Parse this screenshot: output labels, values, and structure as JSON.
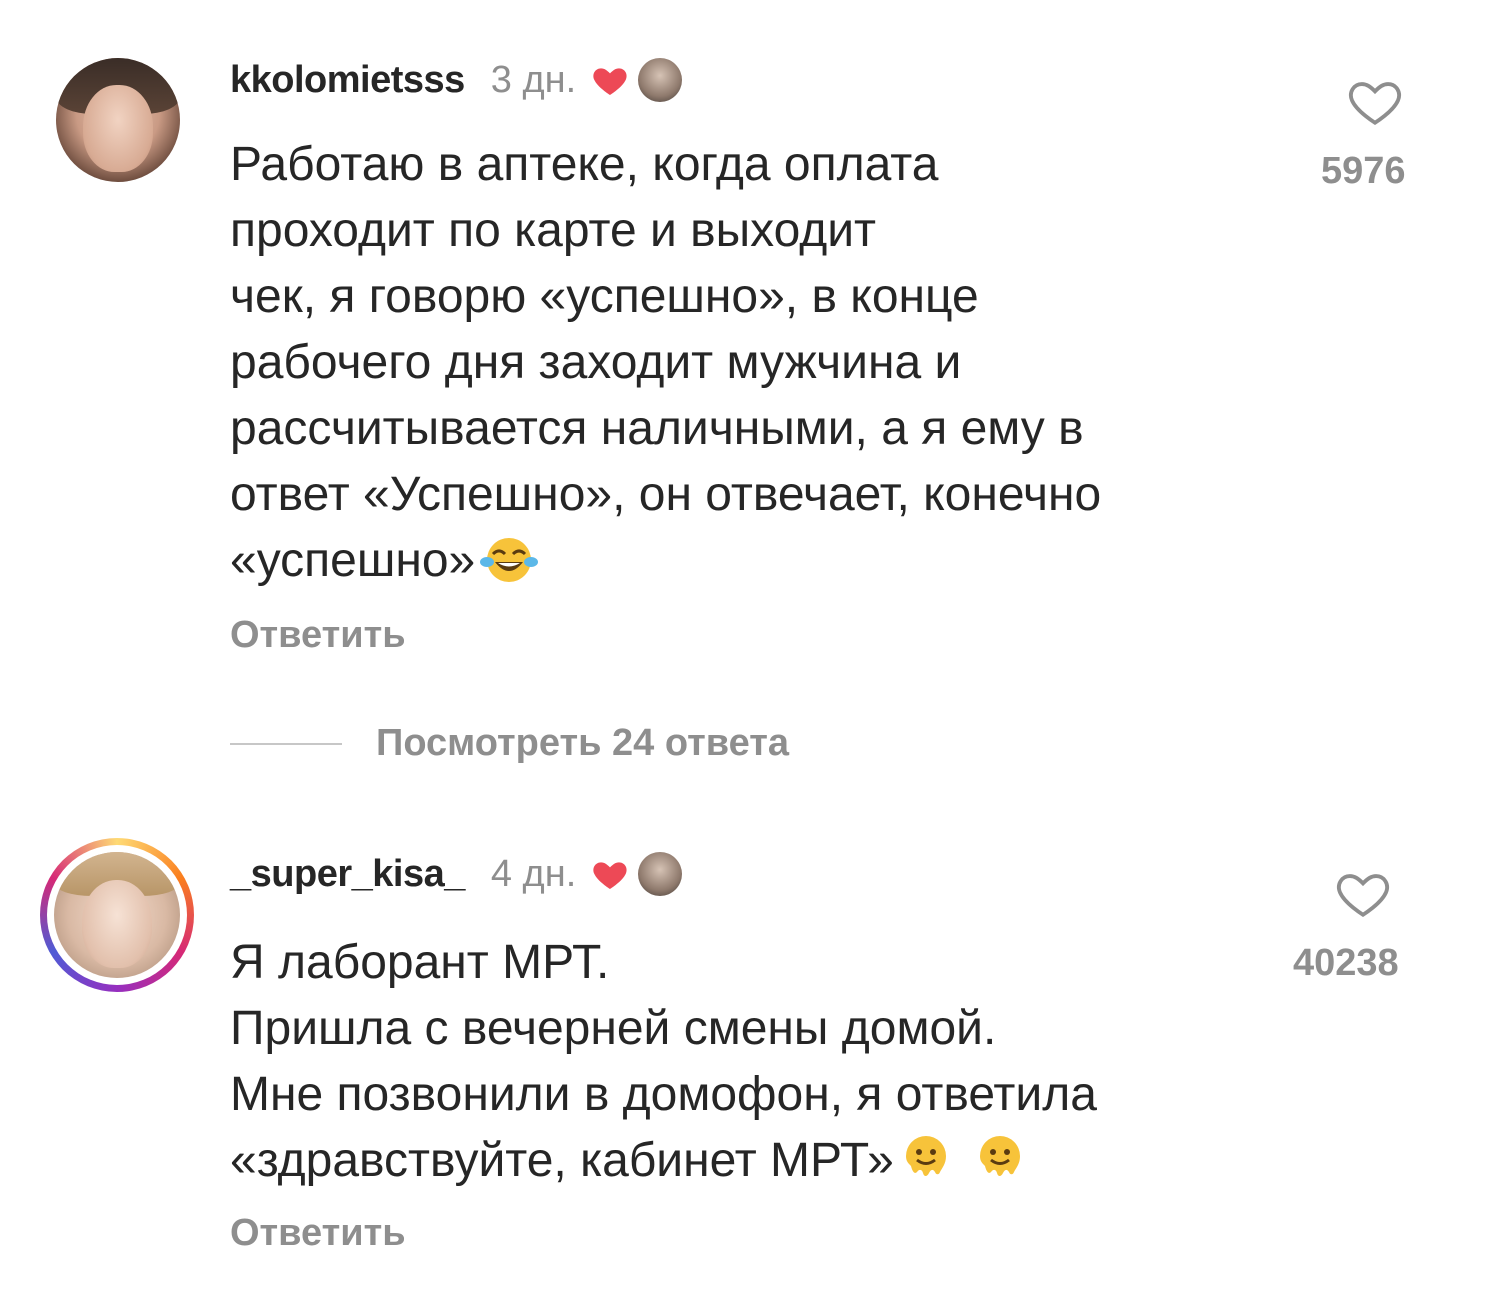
{
  "comments": [
    {
      "username": "kkolomietsss",
      "time": "3 дн.",
      "lines": [
        "Работаю в аптеке, когда оплата",
        "проходит по карте и выходит",
        "чек, я говорю «успешно», в конце",
        "рабочего дня заходит мужчина и",
        "рассчитывается наличными, а я ему в",
        "ответ «Успешно», он отвечает, конечно",
        "«успешно»"
      ],
      "likes": "5976",
      "reply_label": "Ответить"
    },
    {
      "username": "_super_kisa_",
      "time": "4 дн.",
      "lines": [
        "Я лаборант МРТ.",
        "Пришла с вечерней смены домой.",
        "Мне позвонили в домофон, я ответила",
        "«здравствуйте, кабинет МРТ»"
      ],
      "likes": "40238",
      "reply_label": "Ответить"
    }
  ],
  "view_replies_label": "Посмотреть 24 ответа",
  "colors": {
    "text": "#262626",
    "secondary": "#8e8e8e",
    "heart": "#ed4956"
  },
  "icons": [
    "heart-filled-icon",
    "heart-outline-icon",
    "laughing-tears-emoji-icon",
    "melting-face-emoji-icon"
  ]
}
